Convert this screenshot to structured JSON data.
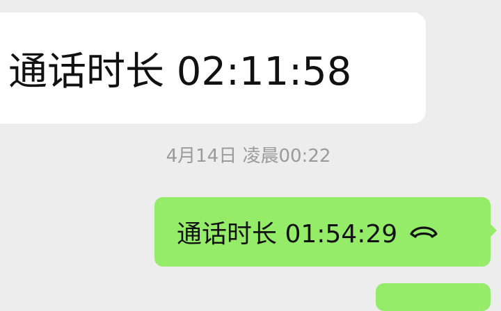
{
  "messages": {
    "incoming": {
      "text": "通话时长 02:11:58"
    },
    "timestamp": "4月14日 凌晨00:22",
    "outgoing": {
      "text": "通话时长 01:54:29",
      "icon": "hang-up-phone-icon"
    }
  },
  "colors": {
    "background": "#ededed",
    "incoming_bubble": "#ffffff",
    "outgoing_bubble": "#95ec69",
    "timestamp_text": "#9a9a9a",
    "message_text": "#111111"
  }
}
